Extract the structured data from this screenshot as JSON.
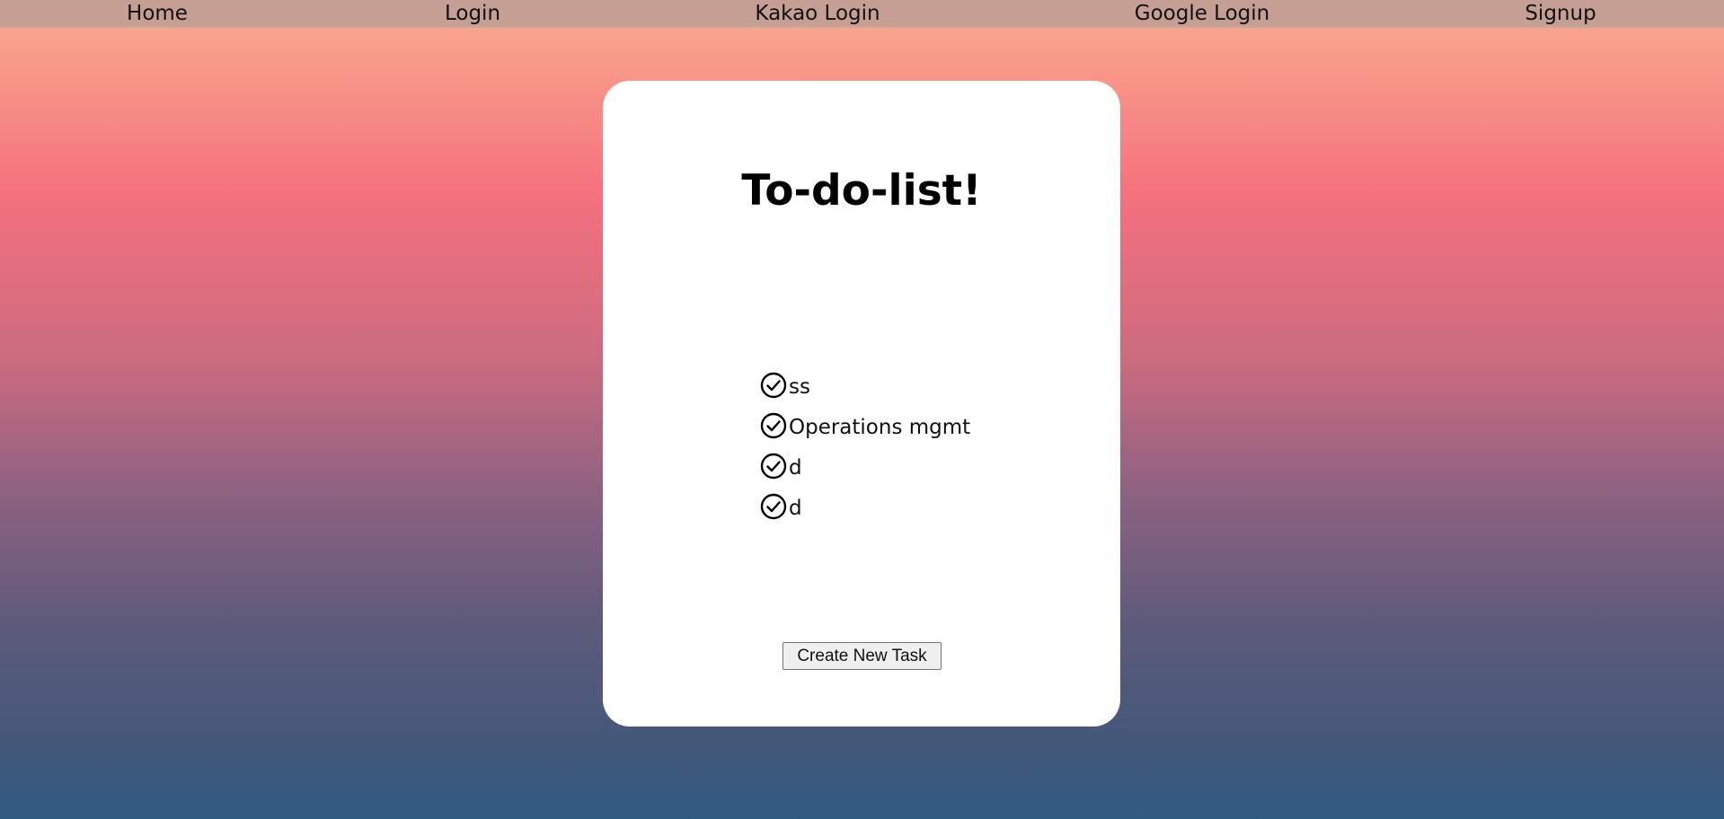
{
  "nav": {
    "home": "Home",
    "login": "Login",
    "kakao_login": "Kakao Login",
    "google_login": "Google Login",
    "signup": "Signup"
  },
  "main": {
    "title": "To-do-list!",
    "tasks": [
      {
        "label": "ss",
        "icon": "check-circle-icon"
      },
      {
        "label": "Operations mgmt",
        "icon": "check-circle-icon"
      },
      {
        "label": "d",
        "icon": "check-circle-icon"
      },
      {
        "label": "d",
        "icon": "check-circle-icon"
      }
    ],
    "create_button": "Create New Task"
  },
  "colors": {
    "nav_bg": "#c59f93",
    "card_bg": "#ffffff",
    "gradient_top": "#fbaa90",
    "gradient_pink": "#f5717e",
    "gradient_purple": "#5c5a7b",
    "gradient_bottom": "#305b80"
  }
}
